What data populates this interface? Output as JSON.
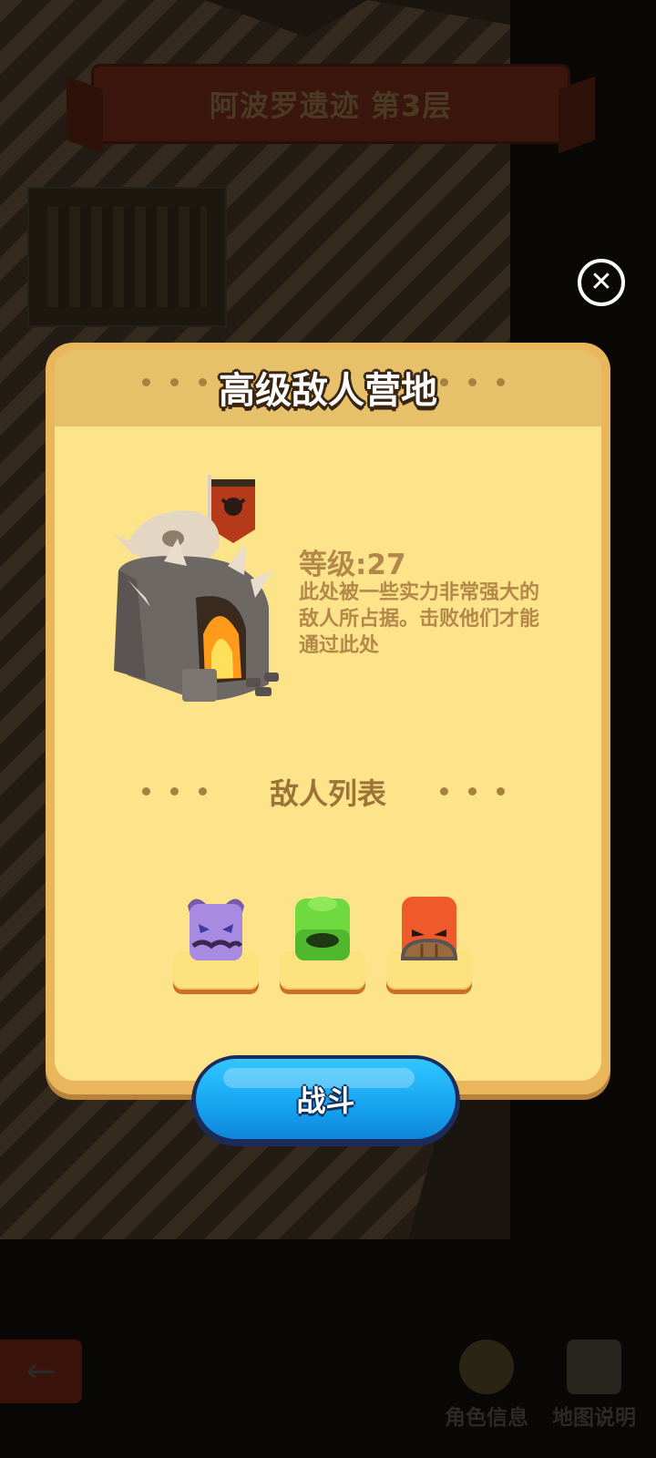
{
  "background": {
    "stage_title": "阿波罗遗迹 第3层",
    "bottom_nav": [
      {
        "label": "角色信息",
        "icon": "character-avatar-icon"
      },
      {
        "label": "地图说明",
        "icon": "map-info-icon"
      }
    ],
    "back_icon": "left-arrow-icon"
  },
  "close_icon": "close-x-icon",
  "dialog": {
    "title": "高级敌人营地",
    "camp_icon": "enemy-camp-icon",
    "level_text": "等级:27",
    "description": "此处被一些实力非常强大的敌人所占据。击败他们才能通过此处",
    "enemy_list_title": "敌人列表",
    "enemies": [
      {
        "icon": "purple-dragon-enemy-icon",
        "color": "#9b7fd6"
      },
      {
        "icon": "green-slime-enemy-icon",
        "color": "#5fcf3c"
      },
      {
        "icon": "red-shield-enemy-icon",
        "color": "#ef5a2c"
      }
    ],
    "fight_label": "战斗"
  },
  "colors": {
    "dialog_frame": "#e9b65c",
    "dialog_body": "#fde48a",
    "text_brown": "#b4884a",
    "button_blue": "#17a6f1"
  }
}
